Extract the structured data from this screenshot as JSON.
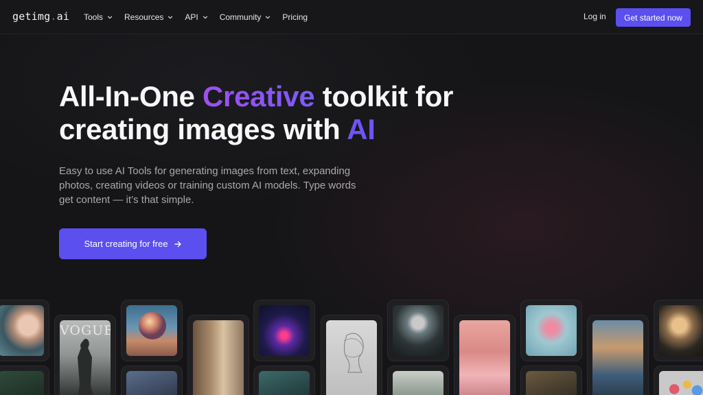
{
  "nav": {
    "logo_main": "getimg",
    "logo_dot": ".",
    "logo_tld": "ai",
    "items": [
      {
        "label": "Tools",
        "has_dropdown": true
      },
      {
        "label": "Resources",
        "has_dropdown": true
      },
      {
        "label": "API",
        "has_dropdown": true
      },
      {
        "label": "Community",
        "has_dropdown": true
      },
      {
        "label": "Pricing",
        "has_dropdown": false
      }
    ],
    "login_label": "Log in",
    "cta_label": "Get started now"
  },
  "hero": {
    "title_part1": "All-In-One ",
    "title_highlight1": "Creative",
    "title_part2": " toolkit for creating images with ",
    "title_highlight2": "AI",
    "subtitle": "Easy to use AI Tools for generating images from text, expanding photos, creating videos or training custom AI models. Type words get content — it’s that simple.",
    "cta_label": "Start creating for free"
  },
  "gallery": {
    "vogue_text": "VOGUE"
  },
  "colors": {
    "accent": "#5b4ff0",
    "highlight_purple": "#a04ef0",
    "logo_dot": "#e0457b",
    "background": "#151517"
  }
}
